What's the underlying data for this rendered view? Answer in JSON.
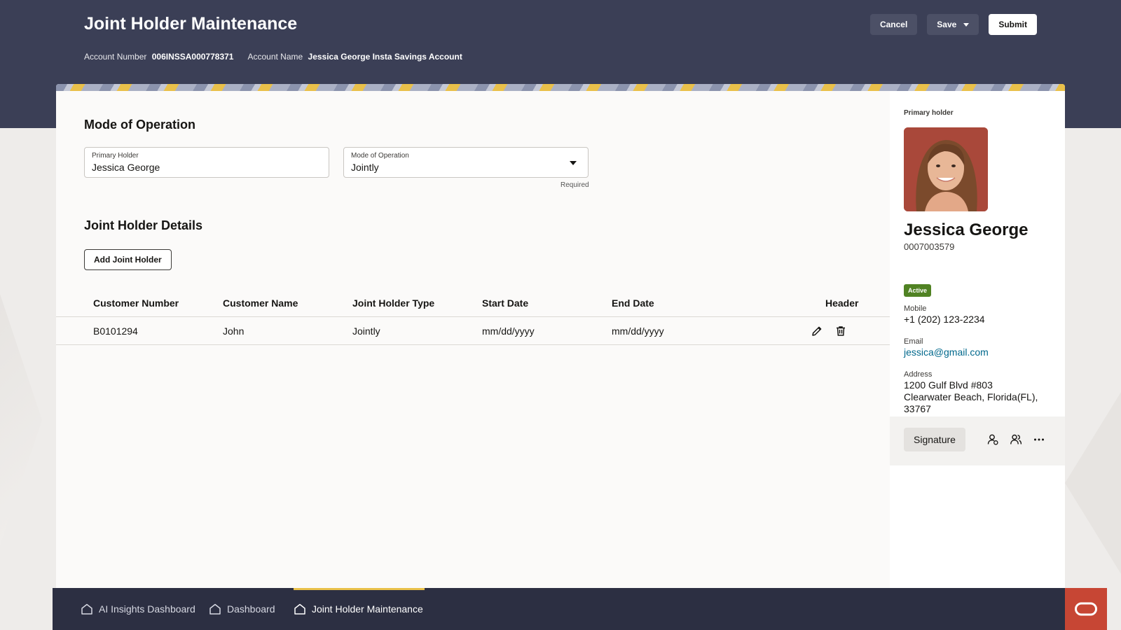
{
  "header": {
    "title": "Joint Holder Maintenance",
    "account_number_label": "Account Number",
    "account_number": "006INSSA000778371",
    "account_name_label": "Account Name",
    "account_name": "Jessica George Insta Savings Account",
    "cancel_label": "Cancel",
    "save_label": "Save",
    "submit_label": "Submit"
  },
  "mode_section": {
    "title": "Mode of Operation",
    "primary_holder_label": "Primary Holder",
    "primary_holder_value": "Jessica George",
    "mode_label": "Mode of Operation",
    "mode_value": "Jointly",
    "required_text": "Required"
  },
  "joint_section": {
    "title": "Joint Holder Details",
    "add_button": "Add Joint Holder",
    "columns": [
      "Customer Number",
      "Customer Name",
      "Joint Holder Type",
      "Start Date",
      "End Date",
      "Header"
    ],
    "rows": [
      {
        "customer_number": "B0101294",
        "customer_name": "John",
        "type": "Jointly",
        "start_date": "mm/dd/yyyy",
        "end_date": "mm/dd/yyyy"
      }
    ]
  },
  "side_panel": {
    "section_label": "Primary holder",
    "name": "Jessica George",
    "customer_id": "0007003579",
    "status": "Active",
    "mobile_label": "Mobile",
    "mobile": "+1 (202) 123-2234",
    "email_label": "Email",
    "email": "jessica@gmail.com",
    "address_label": "Address",
    "address_line1": "1200 Gulf Blvd #803",
    "address_line2": "Clearwater Beach, Florida(FL),",
    "address_line3": "33767",
    "signature_label": "Signature"
  },
  "footer": {
    "tabs": [
      {
        "label": "AI Insights Dashboard",
        "icon": "home-icon"
      },
      {
        "label": "Dashboard",
        "icon": "home-icon"
      },
      {
        "label": "Joint Holder Maintenance",
        "icon": "home-icon"
      }
    ],
    "active_tab": "Joint Holder Maintenance"
  },
  "colors": {
    "header_bg": "#3b3f56",
    "footer_bg": "#2c2f42",
    "accent_yellow": "#e9c04a",
    "status_green": "#508223",
    "link_teal": "#00688c",
    "brand_red": "#c74634"
  }
}
